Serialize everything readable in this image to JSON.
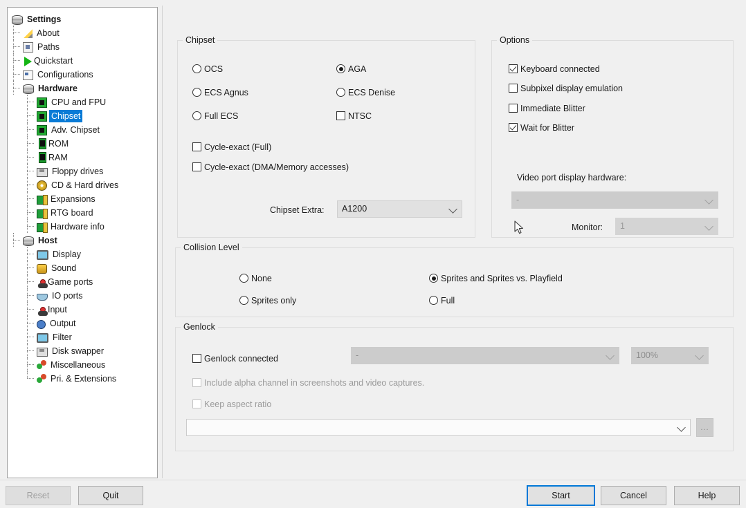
{
  "sidebar": {
    "items": [
      {
        "label": "Settings",
        "icon": "stack-icon",
        "depth": 0,
        "bold": true,
        "selected": false
      },
      {
        "label": "About",
        "icon": "pen-icon",
        "depth": 1,
        "bold": false,
        "selected": false
      },
      {
        "label": "Paths",
        "icon": "paths-icon",
        "depth": 1,
        "bold": false,
        "selected": false
      },
      {
        "label": "Quickstart",
        "icon": "play-icon",
        "depth": 1,
        "bold": false,
        "selected": false
      },
      {
        "label": "Configurations",
        "icon": "config-icon",
        "depth": 1,
        "bold": false,
        "selected": false
      },
      {
        "label": "Hardware",
        "icon": "stack-icon",
        "depth": 1,
        "bold": true,
        "selected": false
      },
      {
        "label": "CPU and FPU",
        "icon": "chip-icon",
        "depth": 2,
        "bold": false,
        "selected": false
      },
      {
        "label": "Chipset",
        "icon": "chip-icon",
        "depth": 2,
        "bold": false,
        "selected": true
      },
      {
        "label": "Adv. Chipset",
        "icon": "chip-icon",
        "depth": 2,
        "bold": false,
        "selected": false
      },
      {
        "label": "ROM",
        "icon": "ram-icon",
        "depth": 2,
        "bold": false,
        "selected": false
      },
      {
        "label": "RAM",
        "icon": "ram-icon",
        "depth": 2,
        "bold": false,
        "selected": false
      },
      {
        "label": "Floppy drives",
        "icon": "floppy-icon",
        "depth": 2,
        "bold": false,
        "selected": false
      },
      {
        "label": "CD & Hard drives",
        "icon": "cd-icon",
        "depth": 2,
        "bold": false,
        "selected": false
      },
      {
        "label": "Expansions",
        "icon": "expansion-icon",
        "depth": 2,
        "bold": false,
        "selected": false
      },
      {
        "label": "RTG board",
        "icon": "expansion-icon",
        "depth": 2,
        "bold": false,
        "selected": false
      },
      {
        "label": "Hardware info",
        "icon": "expansion-icon",
        "depth": 2,
        "bold": false,
        "selected": false
      },
      {
        "label": "Host",
        "icon": "stack-icon",
        "depth": 1,
        "bold": true,
        "selected": false
      },
      {
        "label": "Display",
        "icon": "monitor-icon",
        "depth": 2,
        "bold": false,
        "selected": false
      },
      {
        "label": "Sound",
        "icon": "sound-icon",
        "depth": 2,
        "bold": false,
        "selected": false
      },
      {
        "label": "Game ports",
        "icon": "joystick-icon",
        "depth": 2,
        "bold": false,
        "selected": false
      },
      {
        "label": "IO ports",
        "icon": "io-icon",
        "depth": 2,
        "bold": false,
        "selected": false
      },
      {
        "label": "Input",
        "icon": "joystick-icon",
        "depth": 2,
        "bold": false,
        "selected": false
      },
      {
        "label": "Output",
        "icon": "output-icon",
        "depth": 2,
        "bold": false,
        "selected": false
      },
      {
        "label": "Filter",
        "icon": "monitor-icon",
        "depth": 2,
        "bold": false,
        "selected": false
      },
      {
        "label": "Disk swapper",
        "icon": "floppy-icon",
        "depth": 2,
        "bold": false,
        "selected": false
      },
      {
        "label": "Miscellaneous",
        "icon": "misc-icon",
        "depth": 2,
        "bold": false,
        "selected": false
      },
      {
        "label": "Pri. & Extensions",
        "icon": "misc-icon",
        "depth": 2,
        "bold": false,
        "selected": false
      }
    ]
  },
  "chipset_group": {
    "title": "Chipset",
    "radios": [
      {
        "label": "OCS",
        "checked": false
      },
      {
        "label": "ECS Agnus",
        "checked": false
      },
      {
        "label": "Full ECS",
        "checked": false
      },
      {
        "label": "AGA",
        "checked": true
      },
      {
        "label": "ECS Denise",
        "checked": false
      }
    ],
    "ntsc": {
      "label": "NTSC",
      "checked": false
    },
    "cycle_exact_full": {
      "label": "Cycle-exact (Full)",
      "checked": false
    },
    "cycle_exact_dma": {
      "label": "Cycle-exact (DMA/Memory accesses)",
      "checked": false
    },
    "chipset_extra_label": "Chipset Extra:",
    "chipset_extra_value": "A1200"
  },
  "options_group": {
    "title": "Options",
    "checks": [
      {
        "label": "Keyboard connected",
        "checked": true
      },
      {
        "label": "Subpixel display emulation",
        "checked": false
      },
      {
        "label": "Immediate Blitter",
        "checked": false
      },
      {
        "label": "Wait for Blitter",
        "checked": true
      }
    ],
    "video_port_label": "Video port display hardware:",
    "video_port_value": "-",
    "monitor_label": "Monitor:",
    "monitor_value": "1"
  },
  "collision_group": {
    "title": "Collision Level",
    "options": [
      {
        "label": "None",
        "checked": false
      },
      {
        "label": "Sprites only",
        "checked": false
      },
      {
        "label": "Sprites and Sprites vs. Playfield",
        "checked": true
      },
      {
        "label": "Full",
        "checked": false
      }
    ]
  },
  "genlock_group": {
    "title": "Genlock",
    "connected": {
      "label": "Genlock connected",
      "checked": false
    },
    "device_value": "-",
    "scale_value": "100%",
    "alpha": {
      "label": "Include alpha channel in screenshots and video captures.",
      "checked": false
    },
    "aspect": {
      "label": "Keep aspect ratio",
      "checked": false
    },
    "file_value": "",
    "browse_label": "..."
  },
  "bottom_bar": {
    "reset_label": "Reset",
    "quit_label": "Quit",
    "start_label": "Start",
    "cancel_label": "Cancel",
    "help_label": "Help"
  },
  "colors": {
    "accent": "#0078d7",
    "selection": "#0a7bd6",
    "window_bg": "#f0f0f0",
    "group_border": "#dcdcdc",
    "combo_bg": "#e1e1e1",
    "disabled_text": "#9b9b9b"
  }
}
